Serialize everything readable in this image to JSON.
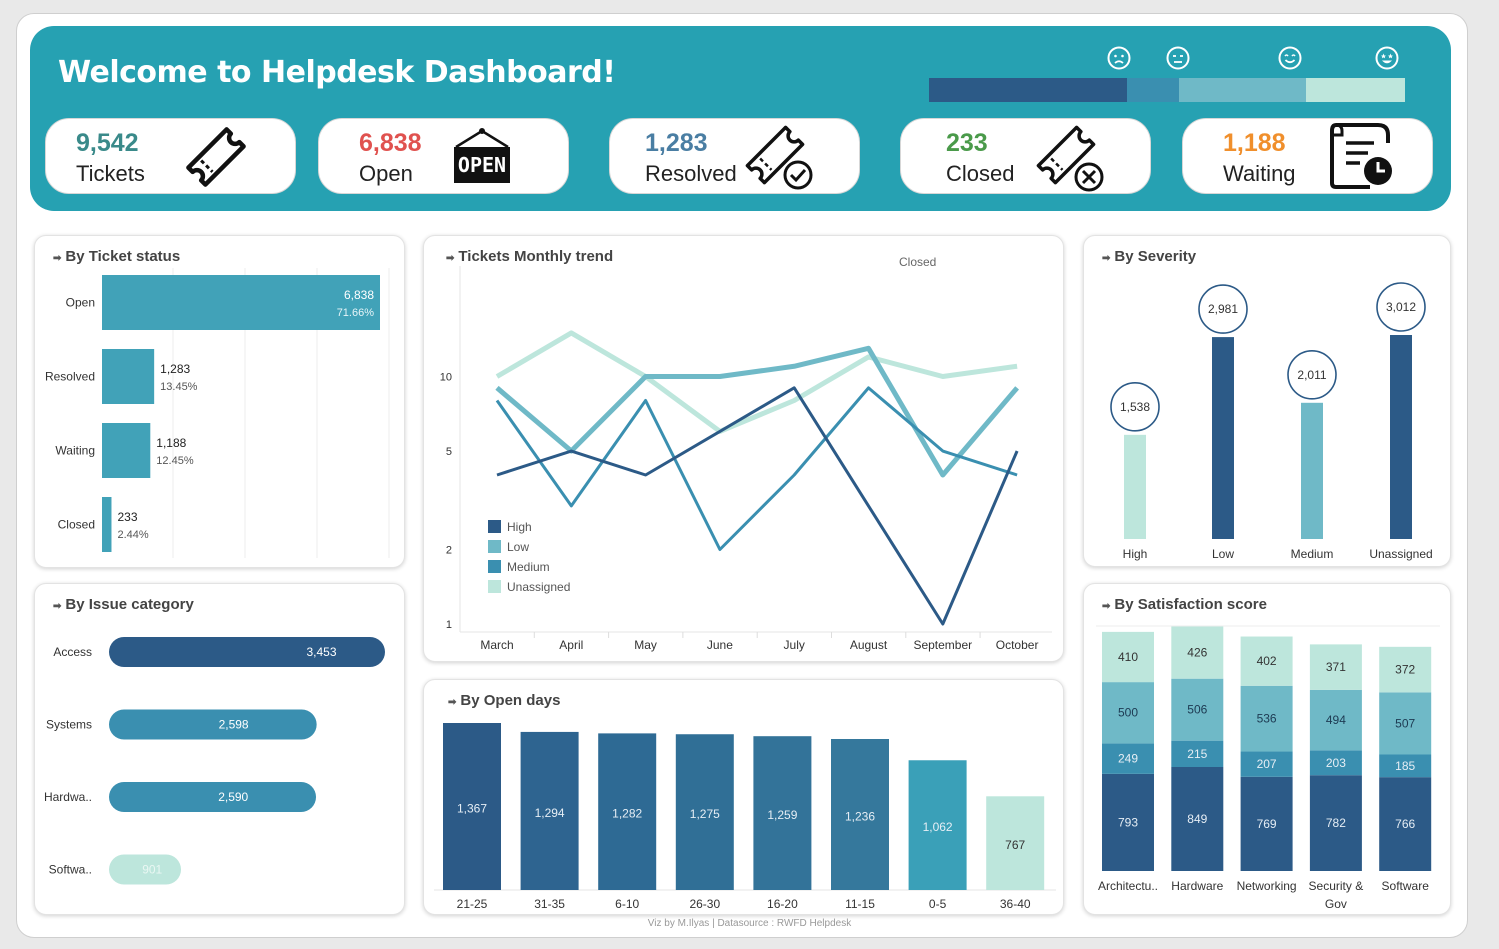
{
  "header": {
    "title": "Welcome to Helpdesk Dashboard!",
    "satisfaction_faces": [
      "sad-face-icon",
      "neutral-face-icon",
      "smile-face-icon",
      "star-eyes-face-icon"
    ],
    "satisfaction_colors": [
      "#2c5a87",
      "#3a8fb0",
      "#6fb9c7",
      "#bde6dc"
    ]
  },
  "kpis": [
    {
      "value": "9,542",
      "label": "Tickets",
      "color": "#3a8a8a",
      "icon": "ticket-icon"
    },
    {
      "value": "6,838",
      "label": "Open",
      "color": "#e0524f",
      "icon": "open-sign-icon"
    },
    {
      "value": "1,283",
      "label": "Resolved",
      "color": "#4a7ea3",
      "icon": "ticket-check-icon"
    },
    {
      "value": "233",
      "label": "Closed",
      "color": "#4a9a4a",
      "icon": "ticket-cancel-icon"
    },
    {
      "value": "1,188",
      "label": "Waiting",
      "color": "#f08f2c",
      "icon": "document-clock-icon"
    }
  ],
  "status": {
    "title": "By Ticket status",
    "chart_data": {
      "type": "bar",
      "categories": [
        "Open",
        "Resolved",
        "Waiting",
        "Closed"
      ],
      "values": [
        6838,
        1283,
        1188,
        233
      ],
      "value_labels": [
        "6,838",
        "1,283",
        "1,188",
        "233"
      ],
      "pct_labels": [
        "71.66%",
        "13.45%",
        "12.45%",
        "2.44%"
      ]
    }
  },
  "trend": {
    "title": "Tickets Monthly trend",
    "annotation": "Closed",
    "chart_data": {
      "type": "line",
      "x": [
        "March",
        "April",
        "May",
        "June",
        "July",
        "August",
        "September",
        "October"
      ],
      "y_ticks": [
        "10",
        "5",
        "2",
        "1"
      ],
      "series": [
        {
          "name": "High",
          "color": "#2c5a87",
          "values": [
            4,
            5,
            4,
            6,
            9,
            3,
            1,
            5
          ]
        },
        {
          "name": "Low",
          "color": "#6fb9c7",
          "values": [
            9,
            5,
            10,
            10,
            11,
            13,
            4,
            9
          ]
        },
        {
          "name": "Medium",
          "color": "#3a8fb0",
          "values": [
            8,
            3,
            8,
            2,
            4,
            9,
            5,
            4
          ]
        },
        {
          "name": "Unassigned",
          "color": "#bde6dc",
          "values": [
            10,
            15,
            10,
            6,
            8,
            12,
            10,
            11
          ]
        }
      ]
    }
  },
  "severity": {
    "title": "By Severity",
    "chart_data": {
      "type": "bar",
      "categories": [
        "High",
        "Low",
        "Medium",
        "Unassigned"
      ],
      "values": [
        1538,
        2981,
        2011,
        3012
      ],
      "value_labels": [
        "1,538",
        "2,981",
        "2,011",
        "3,012"
      ],
      "colors": [
        "#bde6dc",
        "#2c5a87",
        "#6fb9c7",
        "#2c5a87"
      ]
    }
  },
  "category": {
    "title": "By Issue category",
    "chart_data": {
      "type": "bar",
      "categories": [
        "Access",
        "Systems",
        "Hardwa..",
        "Softwa.."
      ],
      "values": [
        3453,
        2598,
        2590,
        901
      ],
      "value_labels": [
        "3,453",
        "2,598",
        "2,590",
        "901"
      ],
      "colors": [
        "#2c5a87",
        "#3a8fb0",
        "#3a8fb0",
        "#bde6dc"
      ]
    }
  },
  "opendays": {
    "title": "By Open days",
    "chart_data": {
      "type": "bar",
      "categories": [
        "21-25",
        "31-35",
        "6-10",
        "26-30",
        "16-20",
        "11-15",
        "0-5",
        "36-40"
      ],
      "values": [
        1367,
        1294,
        1282,
        1275,
        1259,
        1236,
        1062,
        767
      ],
      "value_labels": [
        "1,367",
        "1,294",
        "1,282",
        "1,275",
        "1,259",
        "1,236",
        "1,062",
        "767"
      ],
      "colors": [
        "#2c5a87",
        "#2e6490",
        "#2e6a94",
        "#306f96",
        "#337399",
        "#35789c",
        "#3aa0b8",
        "#bde6dc"
      ]
    }
  },
  "satisfaction": {
    "title": "By Satisfaction score",
    "chart_data": {
      "type": "bar",
      "stacked": true,
      "categories": [
        "Architectu..",
        "Hardware",
        "Networking",
        "Security & Gov",
        "Software"
      ],
      "category_lines": [
        [
          "Architectu.."
        ],
        [
          "Hardware"
        ],
        [
          "Networking"
        ],
        [
          "Security &",
          "Gov"
        ],
        [
          "Software"
        ]
      ],
      "series": [
        {
          "values": [
            793,
            849,
            769,
            782,
            766
          ],
          "color": "#2c5a87"
        },
        {
          "values": [
            249,
            215,
            207,
            203,
            185
          ],
          "color": "#3a8fb0"
        },
        {
          "values": [
            500,
            506,
            536,
            494,
            507
          ],
          "color": "#6fb9c7"
        },
        {
          "values": [
            410,
            426,
            402,
            371,
            372
          ],
          "color": "#bde6dc"
        }
      ]
    }
  },
  "footer": "Viz by M.Ilyas | Datasource : RWFD Helpdesk"
}
